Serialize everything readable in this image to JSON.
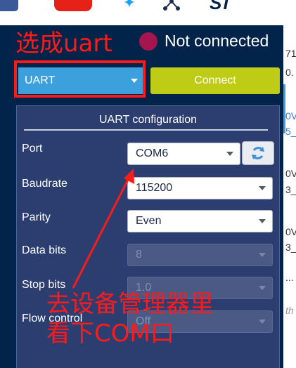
{
  "top_icons": [
    "facebook-icon",
    "youtube-icon",
    "twitter-icon",
    "share-icon",
    "st-logo"
  ],
  "status": {
    "text": "Not connected",
    "dot_color": "#a5154f"
  },
  "interface_select": {
    "value": "UART"
  },
  "connect_button": {
    "label": "Connect"
  },
  "config": {
    "title": "UART configuration",
    "fields": [
      {
        "label": "Port",
        "value": "COM6",
        "enabled": true
      },
      {
        "label": "Baudrate",
        "value": "115200",
        "enabled": true
      },
      {
        "label": "Parity",
        "value": "Even",
        "enabled": true
      },
      {
        "label": "Data bits",
        "value": "8",
        "enabled": false
      },
      {
        "label": "Stop bits",
        "value": "1.0",
        "enabled": false
      },
      {
        "label": "Flow control",
        "value": "Off",
        "enabled": false
      }
    ]
  },
  "annotations": {
    "top": "选成uart",
    "bottom_line1": "去设备管理器里",
    "bottom_line2": "看下COM口"
  },
  "right_strip": [
    "71",
    "0.",
    "0V",
    "5_",
    "0V",
    "3_",
    "0V",
    "3_",
    "...",
    "th"
  ],
  "colors": {
    "panel": "#02234a",
    "config_bg": "#2c3e70",
    "select_blue": "#3ca0dc",
    "connect_green": "#bfcc16",
    "annotation_red": "#ff1a1a"
  }
}
